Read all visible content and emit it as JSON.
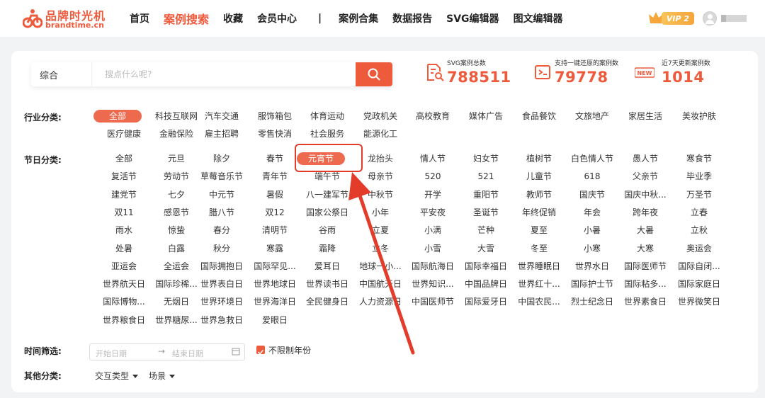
{
  "brand": {
    "name_cn": "品牌时光机",
    "name_en": "brandtime.cn"
  },
  "nav": {
    "items": [
      {
        "label": "首页",
        "active": false
      },
      {
        "label": "案例搜索",
        "active": true
      },
      {
        "label": "收藏",
        "active": false
      },
      {
        "label": "会员中心",
        "active": false
      }
    ],
    "separator": "|",
    "items2": [
      {
        "label": "案例合集"
      },
      {
        "label": "数据报告"
      },
      {
        "label": "SVG编辑器"
      },
      {
        "label": "图文编辑器"
      }
    ],
    "vip_label": "VIP 2"
  },
  "search": {
    "type_label": "综合",
    "placeholder": "搜点什么呢?"
  },
  "stats": [
    {
      "label": "SVG案例总数",
      "value": "788511",
      "icon": "document-search-icon"
    },
    {
      "label": "支持一键还原的案例数",
      "value": "79778",
      "icon": "restore-icon"
    },
    {
      "label": "近7天更新案例数",
      "value": "1014",
      "icon": "new-badge-icon",
      "badge": "NEW"
    }
  ],
  "industry": {
    "label": "行业分类:",
    "rows": [
      [
        "全部",
        "科技互联网",
        "汽车交通",
        "服饰箱包",
        "体育运动",
        "党政机关",
        "高校教育",
        "媒体广告",
        "食品餐饮",
        "文旅地产",
        "家居生活",
        "美妆护肤"
      ],
      [
        "医疗健康",
        "金融保险",
        "雇主招聘",
        "零售快消",
        "社会服务",
        "能源化工"
      ]
    ],
    "active": "全部"
  },
  "festival": {
    "label": "节日分类:",
    "rows": [
      [
        "全部",
        "元旦",
        "除夕",
        "春节",
        "元宵节",
        "龙抬头",
        "情人节",
        "妇女节",
        "植树节",
        "白色情人节",
        "愚人节",
        "寒食节"
      ],
      [
        "复活节",
        "劳动节",
        "草莓音乐节",
        "青年节",
        "端午节",
        "母亲节",
        "520",
        "521",
        "儿童节",
        "618",
        "父亲节",
        "毕业季"
      ],
      [
        "建党节",
        "七夕",
        "中元节",
        "暑假",
        "八一建军节",
        "中秋节",
        "开学",
        "重阳节",
        "教师节",
        "国庆节",
        "国庆中秋...",
        "万圣节"
      ],
      [
        "双11",
        "感恩节",
        "腊八节",
        "双12",
        "国家公祭日",
        "小年",
        "平安夜",
        "圣诞节",
        "年终促销",
        "年会",
        "跨年夜",
        "立春"
      ],
      [
        "雨水",
        "惊蛰",
        "春分",
        "清明节",
        "谷雨",
        "立夏",
        "小满",
        "芒种",
        "夏至",
        "小暑",
        "大暑",
        "立秋"
      ],
      [
        "处暑",
        "白露",
        "秋分",
        "寒露",
        "霜降",
        "立冬",
        "小雪",
        "大雪",
        "冬至",
        "小寒",
        "大寒",
        "奥运会"
      ],
      [
        "亚运会",
        "全运会",
        "国际拥抱日",
        "国际罕见...",
        "爱耳日",
        "地球一小...",
        "国际航海日",
        "国际幸福日",
        "世界睡眠日",
        "世界水日",
        "国际医师节",
        "国际自闭..."
      ],
      [
        "世界航天日",
        "国际珍稀...",
        "世界表白日",
        "世界地球日",
        "世界读书日",
        "中国航天日",
        "世界知识...",
        "中国品牌日",
        "世界红十...",
        "国际护士节",
        "国际粘多...",
        "国际家庭日"
      ],
      [
        "国际博物...",
        "无烟日",
        "世界环境日",
        "世界海洋日",
        "全民健身日",
        "人力资源日",
        "中国医师节",
        "国际爱牙日",
        "中国农民...",
        "烈士纪念日",
        "世界素食日",
        "世界微笑日"
      ],
      [
        "世界粮食日",
        "世界糖尿...",
        "世界急救日",
        "爱眼日"
      ]
    ],
    "active": "元宵节"
  },
  "time_filter": {
    "label": "时间筛选:",
    "start_placeholder": "开始日期",
    "arrow": "→",
    "end_placeholder": "结束日期",
    "checkbox_label": "不限制年份",
    "checkbox_checked": true
  },
  "other": {
    "label": "其他分类:",
    "dropdowns": [
      "交互类型",
      "场景"
    ]
  },
  "colors": {
    "accent": "#ee5a3c",
    "highlight": "#e43c2b"
  }
}
